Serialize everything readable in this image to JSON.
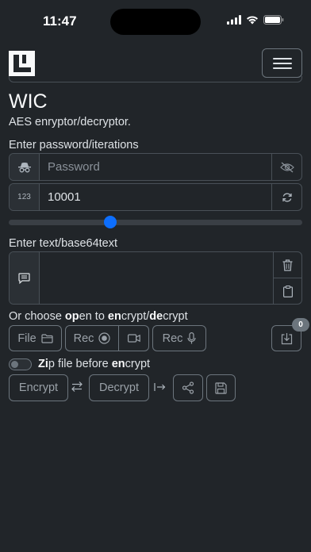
{
  "status": {
    "time": "11:47"
  },
  "header": {
    "logo": "wic-logo-icon",
    "menu": "hamburger-icon"
  },
  "app": {
    "title": "WIC",
    "subtitle": "AES enryptor/decryptor."
  },
  "password_section": {
    "label": "Enter password/iterations",
    "password_placeholder": "Password",
    "iterations_addon": "123",
    "iterations_value": "10001",
    "slider_fraction": 0.34
  },
  "text_section": {
    "label": "Enter text/base64text",
    "textarea_value": ""
  },
  "open_section": {
    "label_parts": [
      "Or choose ",
      "op",
      "en to ",
      "en",
      "crypt/",
      "de",
      "crypt"
    ],
    "file_label": "File",
    "rec_label": "Rec",
    "rec_audio_label": "Rec",
    "badge_count": "0"
  },
  "zip": {
    "label_bold": "Zi",
    "label_mid": "p file before ",
    "label_bold2": "en",
    "label_end": "crypt",
    "checked": false
  },
  "actions": {
    "encrypt_label": "Encrypt",
    "decrypt_label": "Decrypt"
  },
  "colors": {
    "background": "#212529",
    "accent": "#0d6efd",
    "border": "#495057"
  }
}
